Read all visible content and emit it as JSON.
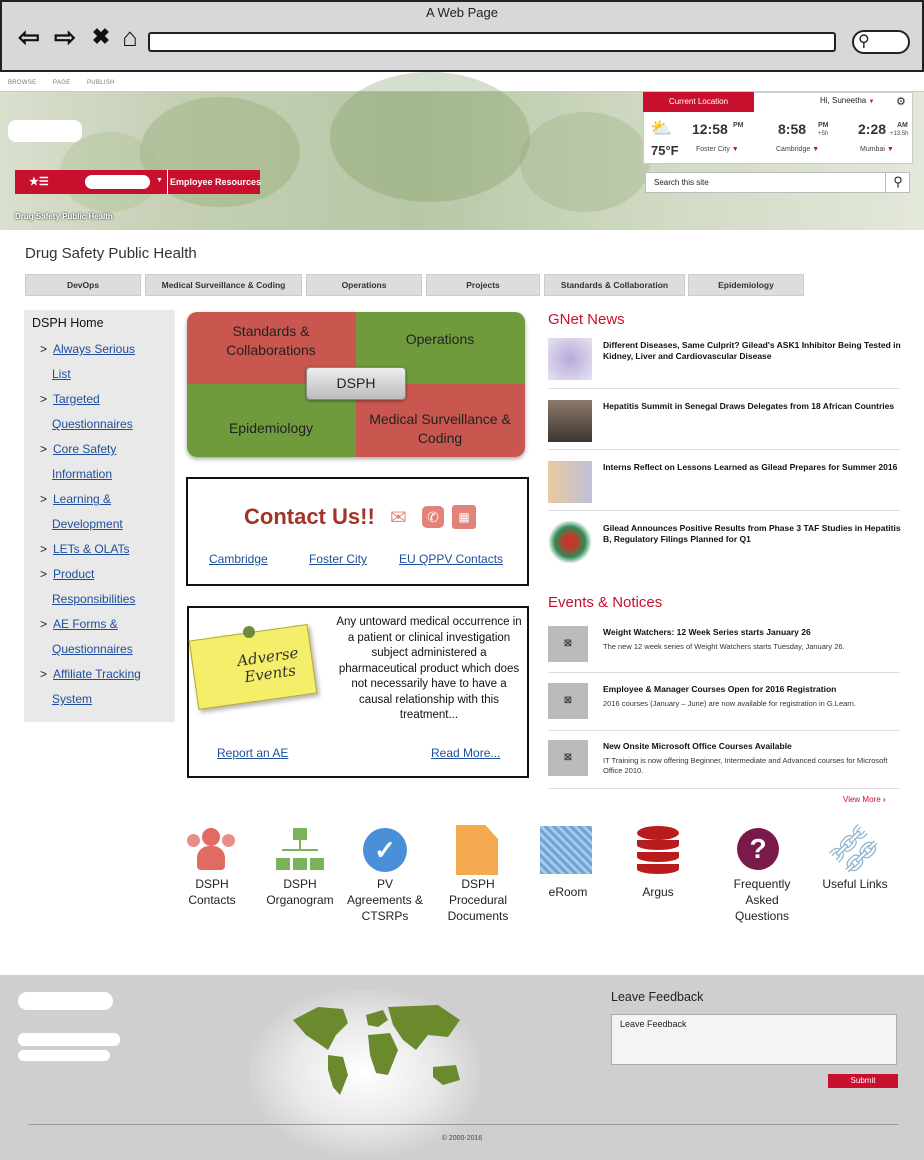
{
  "browser": {
    "title": "A Web Page"
  },
  "ribbon": {
    "items": [
      "BROWSE",
      "PAGE",
      "PUBLISH"
    ]
  },
  "header": {
    "current_location": "Current Location",
    "greeting": "Hi, Suneetha",
    "location1": {
      "time": "12:58",
      "ampm": "PM",
      "temp": "75°F",
      "city": "Foster City"
    },
    "location2": {
      "time": "8:58",
      "ampm": "PM",
      "offset": "+5h",
      "city": "Cambridge"
    },
    "location3": {
      "time": "2:28",
      "ampm": "AM",
      "offset": "+13.5h",
      "city": "Mumbai"
    },
    "search_placeholder": "Search this site",
    "employee_resources": "Employee Resources",
    "breadcrumb": "Drug Safety Public Health"
  },
  "page": {
    "title": "Drug Safety Public Health",
    "tabs": [
      "DevOps",
      "Medical Surveillance & Coding",
      "Operations",
      "Projects",
      "Standards & Collaboration",
      "Epidemiology"
    ]
  },
  "leftnav": {
    "home": "DSPH Home",
    "items": [
      [
        "Always Serious",
        "List"
      ],
      [
        "Targeted",
        "Questionnaires"
      ],
      [
        "Core Safety",
        "Information"
      ],
      [
        "Learning &",
        "Development"
      ],
      [
        "LETs & OLATs"
      ],
      [
        "Product",
        "Responsibilities"
      ],
      [
        "AE Forms &",
        "Questionnaires"
      ],
      [
        "Affiliate Tracking",
        "System"
      ]
    ]
  },
  "quadrants": {
    "top_left": "Standards & Collaborations",
    "top_right": "Operations",
    "bottom_left": "Epidemiology",
    "bottom_right": "Medical Surveillance & Coding",
    "center": "DSPH"
  },
  "contact": {
    "title": "Contact Us!!",
    "links": [
      "Cambridge",
      "Foster City",
      "EU QPPV Contacts"
    ]
  },
  "adverse_events": {
    "note": "Adverse Events",
    "text": "Any untoward medical occurrence in a patient or clinical investigation subject administered a pharmaceutical product which does not necessarily have to have a causal relationship with this treatment...",
    "report_link": "Report an AE",
    "read_more": "Read More..."
  },
  "news": {
    "title": "GNet News",
    "items": [
      "Different Diseases, Same Culprit? Gilead's ASK1 Inhibitor Being Tested in Kidney, Liver and Cardiovascular Disease",
      "Hepatitis Summit in Senegal Draws Delegates from 18 African Countries",
      "Interns Reflect on Lessons Learned as Gilead Prepares for Summer 2016",
      "Gilead Announces Positive Results from Phase 3 TAF Studies in Hepatitis B, Regulatory Filings Planned for Q1"
    ]
  },
  "events": {
    "title": "Events & Notices",
    "items": [
      {
        "title": "Weight Watchers: 12 Week Series starts January 26",
        "text": "The new 12 week series of Weight Watchers starts Tuesday, January 26."
      },
      {
        "title": "Employee & Manager Courses Open for 2016 Registration",
        "text": "2016 courses (January – June) are now available for registration in G.Learn."
      },
      {
        "title": "New Onsite Microsoft Office Courses Available",
        "text": "IT Training is now offering Beginner, Intermediate and Advanced courses for Microsoft Office 2010."
      }
    ],
    "view_more": "View More"
  },
  "quicklinks": [
    {
      "label": "DSPH Contacts",
      "icon": "people-icon"
    },
    {
      "label": "DSPH Organogram",
      "icon": "org-chart-icon"
    },
    {
      "label": "PV Agreements & CTSRPs",
      "icon": "check-circle-icon"
    },
    {
      "label": "DSPH Procedural Documents",
      "icon": "document-icon"
    },
    {
      "label": "eRoom",
      "icon": "eroom-icon"
    },
    {
      "label": "Argus",
      "icon": "database-icon"
    },
    {
      "label": "Frequently Asked Questions",
      "icon": "question-icon"
    },
    {
      "label": "Useful Links",
      "icon": "link-icon"
    }
  ],
  "footer": {
    "feedback_title": "Leave Feedback",
    "feedback_placeholder": "Leave Feedback",
    "submit": "Submit",
    "copyright": "© 2000-2016"
  },
  "colors": {
    "brand_red": "#c8102e",
    "quad_red": "#c9574f",
    "quad_green": "#6f9b3d",
    "link_blue": "#1f4e9c"
  }
}
